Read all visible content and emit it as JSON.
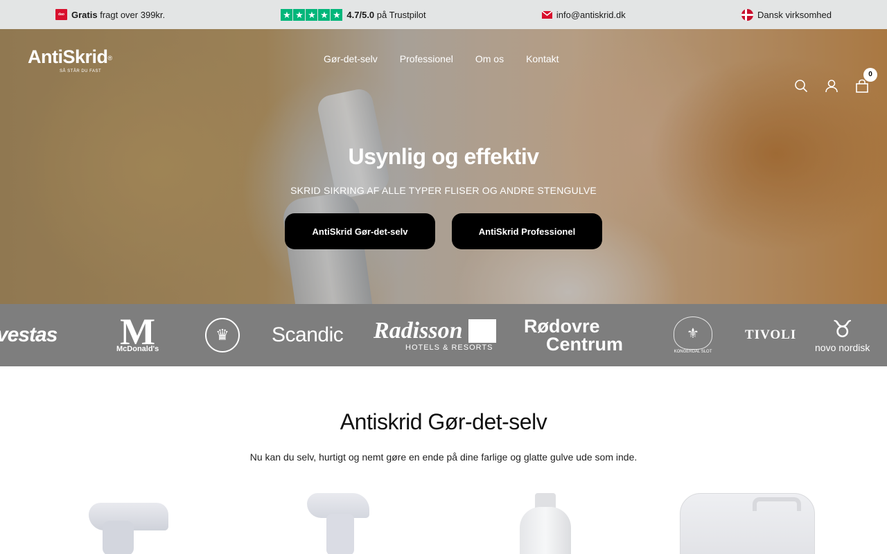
{
  "topbar": {
    "dao_label": "dao",
    "shipping_bold": "Gratis",
    "shipping_rest": "fragt over 399kr.",
    "rating_value": "4.7/5.0",
    "rating_rest": "på Trustpilot",
    "email": "info@antiskrid.dk",
    "company_note": "Dansk virksomhed"
  },
  "header": {
    "logo_name": "AntiSkrid",
    "logo_registered": "®",
    "logo_tagline": "SÅ STÅR DU FAST",
    "nav": [
      "Gør-det-selv",
      "Professionel",
      "Om os",
      "Kontakt"
    ],
    "cart_count": "0"
  },
  "hero": {
    "title": "Usynlig og effektiv",
    "subtitle": "SKRID SIKRING AF ALLE TYPER FLISER OG ANDRE STENGULVE",
    "button_diy": "AntiSkrid Gør-det-selv",
    "button_pro": "AntiSkrid Professionel"
  },
  "brands": {
    "vestas": "vestas",
    "mcdonalds_mark": "M",
    "mcdonalds": "McDonald's",
    "scandic": "Scandic",
    "radisson": "Radisson",
    "radisson_sub": "HOTELS & RESORTS",
    "rodovre_1": "Rødovre",
    "rodovre_2": "Centrum",
    "kongerdal": "KONGERDAL SLOT",
    "tivoli": "TIVOLI",
    "novo": "novo nordisk"
  },
  "section": {
    "title": "Antiskrid Gør-det-selv",
    "text": "Nu kan du selv, hurtigt og nemt gøre en ende på dine farlige og glatte gulve ude som inde."
  },
  "colors": {
    "trustpilot_green": "#00b67a",
    "button_bg": "#000000",
    "topbar_bg": "#e3e5e5",
    "brand_strip_bg": "#7e7e7e"
  },
  "icons": [
    "dao-badge-icon",
    "trustpilot-star-icon",
    "mail-icon",
    "danish-flag-icon",
    "search-icon",
    "account-icon",
    "cart-icon"
  ]
}
